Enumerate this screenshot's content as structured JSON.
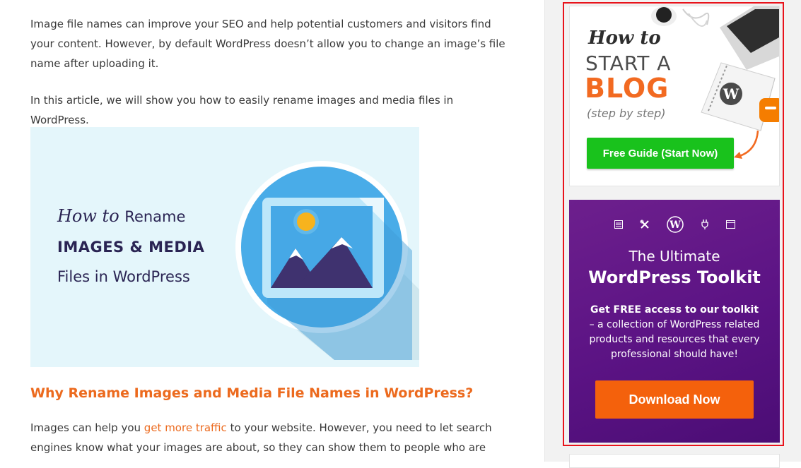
{
  "article": {
    "intro": "Image file names can improve your SEO and help potential customers and visitors find your content. However, by default WordPress doesn’t allow you to change an image’s file name after uploading it.",
    "summary": "In this article, we will show you how to easily rename images and media files in WordPress.",
    "hero": {
      "howto": "How to",
      "rename": "Rename",
      "big": "IMAGES & MEDIA",
      "sub": "Files in WordPress"
    },
    "heading": "Why Rename Images and Media File Names in WordPress?",
    "body_before_link": "Images can help you ",
    "body_link": "get more traffic",
    "body_after_link": " to your website. However, you need to let search engines know what your images are about, so they can show them to people who are"
  },
  "sidebar": {
    "blog_ad": {
      "howto": "How to",
      "start": "START A",
      "blog": "BLOG",
      "step": "(step by step)",
      "button": "Free Guide (Start Now)"
    },
    "toolkit_ad": {
      "icons": [
        "server-icon",
        "tools-icon",
        "wordpress-icon",
        "plug-icon",
        "browser-icon"
      ],
      "line1": "The Ultimate",
      "line2": "WordPress Toolkit",
      "desc_bold": "Get FREE access to our toolkit",
      "desc_rest": " – a collection of WordPress related products and resources that every professional should have!",
      "button": "Download Now"
    }
  },
  "colors": {
    "accent": "#ec6a1e",
    "highlight": "#e8131b",
    "green": "#19c21c",
    "purple": "#5b1384",
    "orange_button": "#f4610c"
  }
}
